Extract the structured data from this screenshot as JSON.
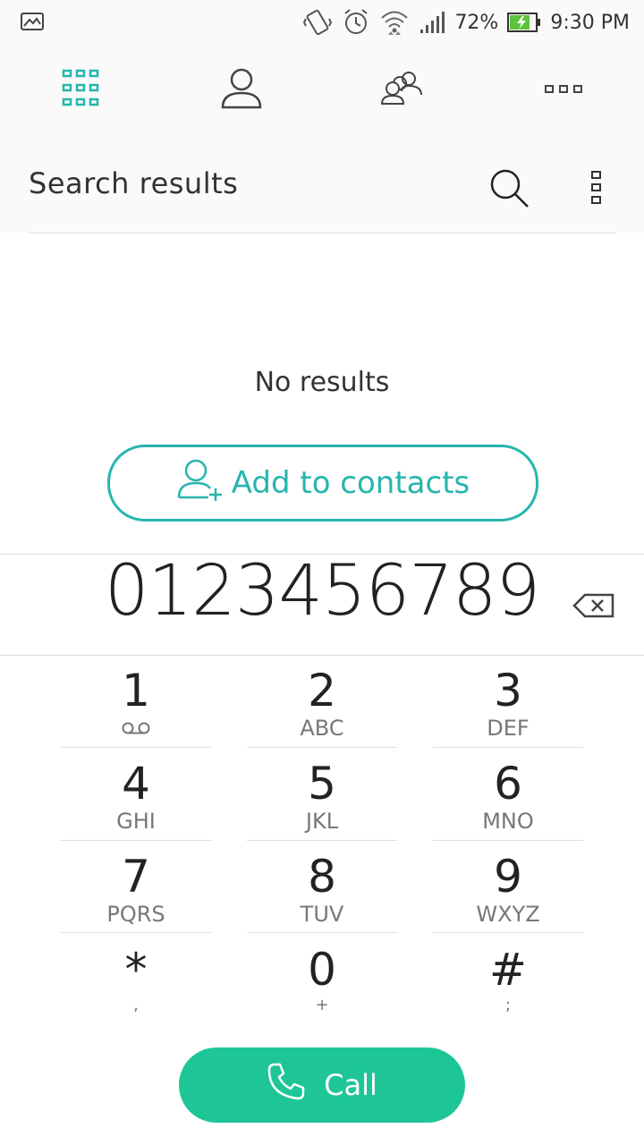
{
  "status_bar": {
    "battery_percent": "72%",
    "time": "9:30 PM"
  },
  "tabs": [
    {
      "icon": "dialpad-grid-icon",
      "active": true
    },
    {
      "icon": "person-icon",
      "active": false
    },
    {
      "icon": "people-group-icon",
      "active": false
    },
    {
      "icon": "more-horizontal-icon",
      "active": false
    }
  ],
  "search": {
    "title": "Search results"
  },
  "results": {
    "empty_text": "No results",
    "add_contacts_label": "Add to contacts"
  },
  "dial": {
    "number": "0123456789"
  },
  "keypad": [
    {
      "digit": "1",
      "sub": ""
    },
    {
      "digit": "2",
      "sub": "ABC"
    },
    {
      "digit": "3",
      "sub": "DEF"
    },
    {
      "digit": "4",
      "sub": "GHI"
    },
    {
      "digit": "5",
      "sub": "JKL"
    },
    {
      "digit": "6",
      "sub": "MNO"
    },
    {
      "digit": "7",
      "sub": "PQRS"
    },
    {
      "digit": "8",
      "sub": "TUV"
    },
    {
      "digit": "9",
      "sub": "WXYZ"
    },
    {
      "digit": "*",
      "sub": ","
    },
    {
      "digit": "0",
      "sub": "+"
    },
    {
      "digit": "#",
      "sub": ";"
    }
  ],
  "call": {
    "label": "Call"
  },
  "colors": {
    "accent_teal": "#26b5ae",
    "call_green": "#1ec697"
  }
}
